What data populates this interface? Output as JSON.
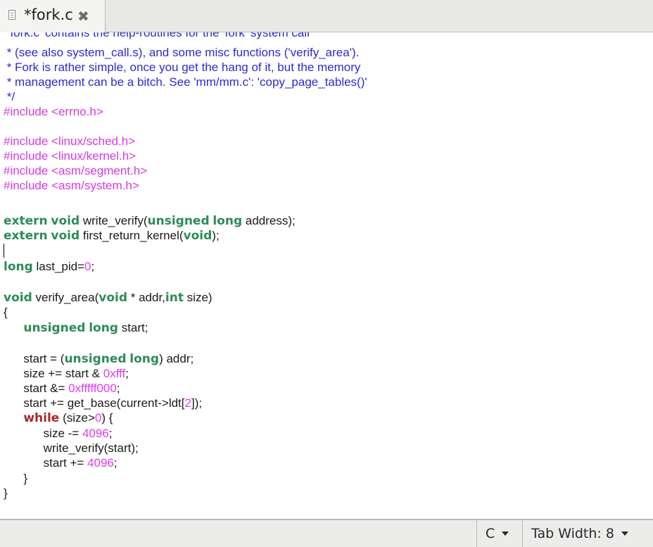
{
  "tab": {
    "title": "*fork.c",
    "icon": "document-icon",
    "close_icon": "close-icon"
  },
  "code_lines": [
    "  fork.c' contains the help-routines for the 'fork' system call",
    " * (see also system_call.s), and some misc functions ('verify_area').",
    " * Fork is rather simple, once you get the hang of it, but the memory",
    " * management can be a bitch. See 'mm/mm.c': 'copy_page_tables()'",
    " */",
    "#include <errno.h>",
    "",
    "#include <linux/sched.h>",
    "#include <linux/kernel.h>",
    "#include <asm/segment.h>",
    "#include <asm/system.h>",
    "",
    "extern void write_verify(unsigned long address);",
    "extern void first_return_kernel(void);",
    "",
    "long last_pid=0;",
    "",
    "void verify_area(void * addr,int size)",
    "{",
    "      unsigned long start;",
    "",
    "      start = (unsigned long) addr;",
    "      size += start & 0xfff;",
    "      start &= 0xfffff000;",
    "      start += get_base(current->ldt[2]);",
    "      while (size>0) {",
    "            size -= 4096;",
    "            write_verify(start);",
    "            start += 4096;",
    "      }",
    "}"
  ],
  "status": {
    "language": "C",
    "tab_width": "Tab Width:  8"
  },
  "colors": {
    "comment": "#2b2bd2",
    "preprocessor": "#d63be0",
    "keyword": "#2e8b57",
    "control": "#a52a2a",
    "number": "#e03cf0"
  }
}
